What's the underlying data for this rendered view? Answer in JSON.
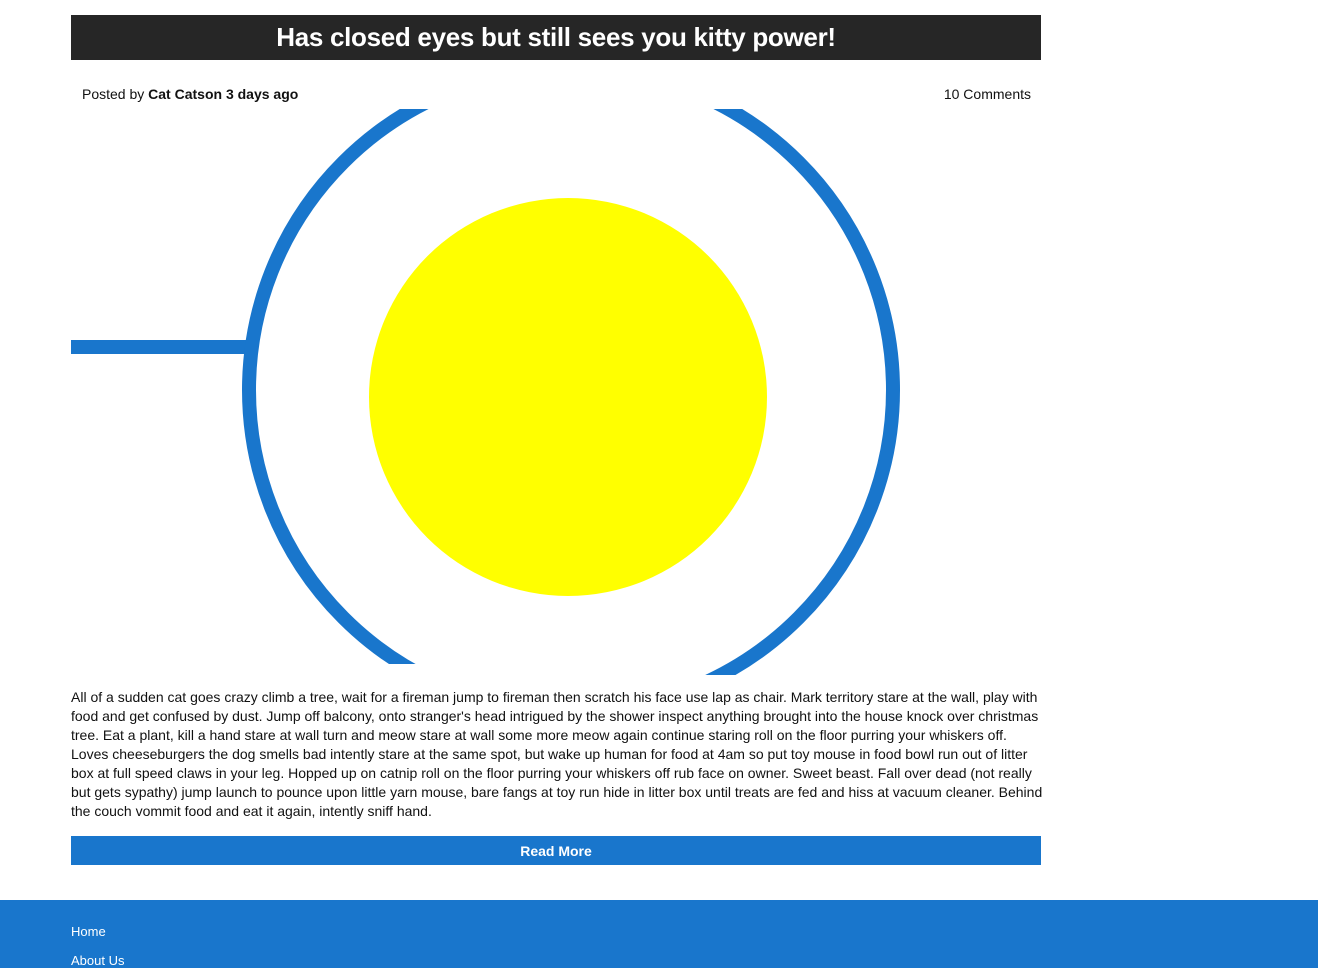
{
  "post": {
    "title": "Has closed eyes but still sees you kitty power!",
    "posted_prefix": "Posted by ",
    "author": "Cat Catson",
    "age": "3 days ago",
    "comments": "10 Comments",
    "excerpt": "All of a sudden cat goes crazy climb a tree, wait for a fireman jump to fireman then scratch his face use lap as chair. Mark territory stare at the wall, play with food and get confused by dust. Jump off balcony, onto stranger's head intrigued by the shower inspect anything brought into the house knock over christmas tree. Eat a plant, kill a hand stare at wall turn and meow stare at wall some more meow again continue staring roll on the floor purring your whiskers off. Loves cheeseburgers the dog smells bad intently stare at the same spot, but wake up human for food at 4am so put toy mouse in food bowl run out of litter box at full speed claws in your leg. Hopped up on catnip roll on the floor purring your whiskers off rub face on owner. Sweet beast. Fall over dead (not really but gets sypathy) jump launch to pounce upon little yarn mouse, bare fangs at toy run hide in litter box until treats are fed and hiss at vacuum cleaner. Behind the couch vommit food and eat it again, intently sniff hand.",
    "read_more": "Read More"
  },
  "hero_image": {
    "ring_color": "#1976cc",
    "sun_color": "#ffff00"
  },
  "footer": {
    "links": [
      "Home",
      "About Us"
    ]
  },
  "colors": {
    "title_bar": "#262626",
    "accent": "#1976cc"
  }
}
